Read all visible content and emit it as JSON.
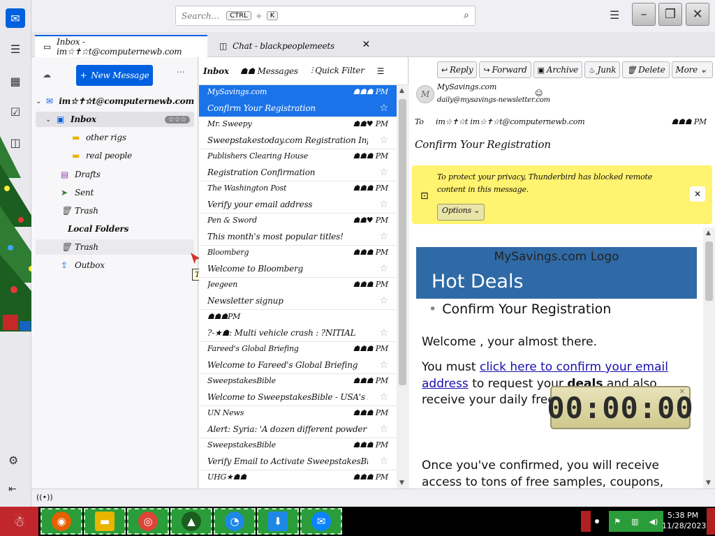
{
  "search": {
    "placeholder": "Search...",
    "key1": "CTRL",
    "key2": "K"
  },
  "tabs": [
    {
      "label": "Inbox - im☆✝☆t@computernewb.com"
    },
    {
      "label": "Chat - blackpeoplemeets"
    }
  ],
  "folder_pane": {
    "new_message": "New Message",
    "account": "im☆✝☆t@computernewb.com",
    "inbox": "Inbox",
    "inbox_badge": "☆☆☆",
    "subfolders": [
      "other rigs",
      "real people"
    ],
    "drafts": "Drafts",
    "sent": "Sent",
    "trash": "Trash",
    "local_folders": "Local Folders",
    "local_trash": "Trash",
    "outbox": "Outbox"
  },
  "drag_tooltip": "Trash",
  "message_list": {
    "title": "Inbox",
    "count": "☗☗ Messages",
    "quick_filter": "Quick Filter",
    "rows": [
      {
        "sender": "MySavings.com",
        "date": "☗☗☗ PM",
        "subject": "Confirm Your Registration",
        "selected": true
      },
      {
        "sender": "Mr. Sweepy",
        "date": "☗☗♥ PM",
        "subject": "Sweepstakestoday.com Registration Information"
      },
      {
        "sender": "Publishers Clearing House",
        "date": "☗☗☗ PM",
        "subject": "Registration Confirmation"
      },
      {
        "sender": "The Washington Post",
        "date": "☗☗☗ PM",
        "subject": "Verify your email address"
      },
      {
        "sender": "Pen & Sword",
        "date": "☗☗♥ PM",
        "subject": "This month's most popular titles!"
      },
      {
        "sender": "Bloomberg",
        "date": "☗☗☗ PM",
        "subject": "Welcome to Bloomberg"
      },
      {
        "sender": "Jeegeen",
        "date": "☗☗☗ PM",
        "subject": "Newsletter signup"
      },
      {
        "sender": "☗☗☗PM",
        "date": "",
        "subject": "?-★☗: Multi vehicle crash : ?NITIAL"
      },
      {
        "sender": "Fareed's Global Briefing",
        "date": "☗☗☗ PM",
        "subject": "Welcome to Fareed's Global Briefing"
      },
      {
        "sender": "SweepstakesBible",
        "date": "☗☗☗ PM",
        "subject": "Welcome to SweepstakesBible - USA's L..."
      },
      {
        "sender": "UN News",
        "date": "☗☗☗ PM",
        "subject": "Alert: Syria: 'A dozen different powder kegs'"
      },
      {
        "sender": "SweepstakesBible",
        "date": "☗☗☗ PM",
        "subject": "Verify Email to Activate SweepstakesBible ..."
      },
      {
        "sender": "UHG★☗☗",
        "date": "☗☗☗ PM",
        "subject": ""
      }
    ]
  },
  "reader": {
    "actions": [
      "Reply",
      "Forward",
      "Archive",
      "Junk",
      "Delete",
      "More"
    ],
    "from_name": "MySavings.com",
    "from_addr": "daily@mysavings-newsletter.com",
    "to_label": "To",
    "to_value": "im☆✝☆t im☆✝☆t@computernewb.com",
    "date": "☗☗☗ PM",
    "subject": "Confirm Your Registration",
    "remote_notice": "To protect your privacy, Thunderbird has blocked remote content in this message.",
    "options_label": "Options",
    "body": {
      "logo_alt": "MySavings.com Logo",
      "banner": "Hot Deals",
      "bullet": "Confirm Your Registration",
      "welcome": "Welcome , your almost there.",
      "p1_before": "You must ",
      "p1_link": "click here to confirm your email address",
      "p1_mid": " to request your ",
      "p1_bold": "deals",
      "p1_after": " and also receive your daily free savings.",
      "p2": "Once you've confirmed, you will receive access to tons of free samples, coupons,"
    }
  },
  "timer": {
    "display": "00:00:00"
  },
  "clock": {
    "time": "5:38 PM",
    "date": "11/28/2023"
  },
  "colors": {
    "accent": "#0060df",
    "selected_row": "#1a73e8",
    "notice": "#fff36f",
    "banner": "#2f6aa6",
    "taskbar_tile": "#2a9d3a"
  }
}
